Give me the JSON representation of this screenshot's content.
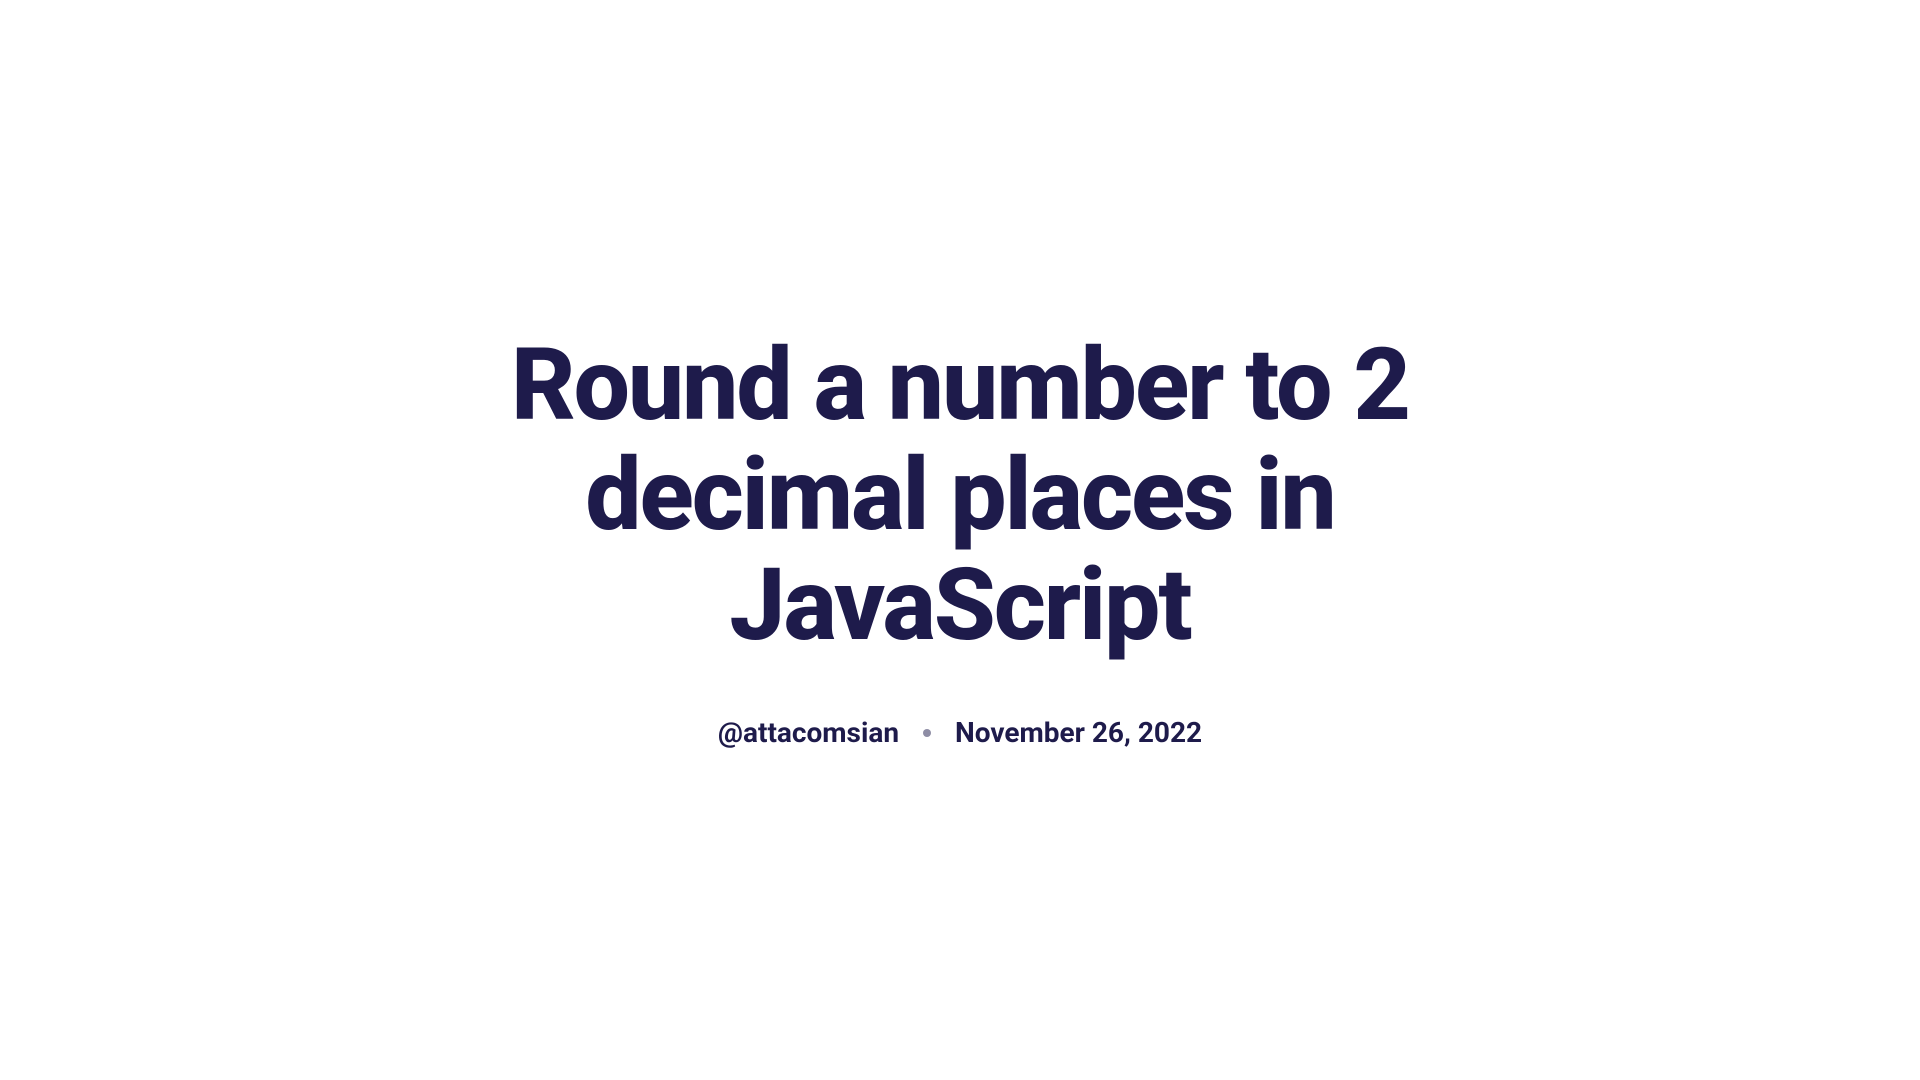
{
  "article": {
    "title": "Round a number to 2 decimal places in JavaScript",
    "author": "@attacomsian",
    "date": "November 26, 2022"
  }
}
